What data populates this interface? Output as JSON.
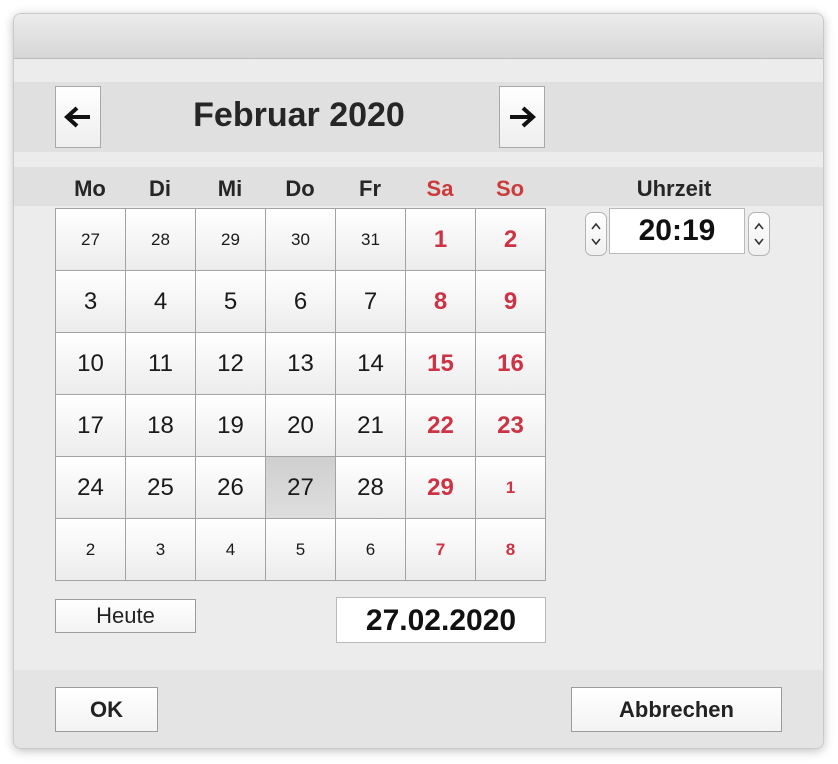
{
  "calendar": {
    "month_label": "Februar 2020",
    "prev_icon": "arrow-left-icon",
    "next_icon": "arrow-right-icon",
    "weekdays": [
      {
        "label": "Mo",
        "weekend": false
      },
      {
        "label": "Di",
        "weekend": false
      },
      {
        "label": "Mi",
        "weekend": false
      },
      {
        "label": "Do",
        "weekend": false
      },
      {
        "label": "Fr",
        "weekend": false
      },
      {
        "label": "Sa",
        "weekend": true
      },
      {
        "label": "So",
        "weekend": true
      }
    ],
    "weeks": [
      [
        {
          "d": "27",
          "other": true
        },
        {
          "d": "28",
          "other": true
        },
        {
          "d": "29",
          "other": true
        },
        {
          "d": "30",
          "other": true
        },
        {
          "d": "31",
          "other": true
        },
        {
          "d": "1"
        },
        {
          "d": "2"
        }
      ],
      [
        {
          "d": "3"
        },
        {
          "d": "4"
        },
        {
          "d": "5"
        },
        {
          "d": "6"
        },
        {
          "d": "7"
        },
        {
          "d": "8"
        },
        {
          "d": "9"
        }
      ],
      [
        {
          "d": "10"
        },
        {
          "d": "11"
        },
        {
          "d": "12"
        },
        {
          "d": "13"
        },
        {
          "d": "14"
        },
        {
          "d": "15"
        },
        {
          "d": "16"
        }
      ],
      [
        {
          "d": "17"
        },
        {
          "d": "18"
        },
        {
          "d": "19"
        },
        {
          "d": "20"
        },
        {
          "d": "21"
        },
        {
          "d": "22"
        },
        {
          "d": "23"
        }
      ],
      [
        {
          "d": "24"
        },
        {
          "d": "25"
        },
        {
          "d": "26"
        },
        {
          "d": "27",
          "selected": true
        },
        {
          "d": "28"
        },
        {
          "d": "29"
        },
        {
          "d": "1",
          "other": true
        }
      ],
      [
        {
          "d": "2",
          "other": true
        },
        {
          "d": "3",
          "other": true
        },
        {
          "d": "4",
          "other": true
        },
        {
          "d": "5",
          "other": true
        },
        {
          "d": "6",
          "other": true
        },
        {
          "d": "7",
          "other": true
        },
        {
          "d": "8",
          "other": true
        }
      ]
    ],
    "today_button": "Heute",
    "date_value": "27.02.2020"
  },
  "time": {
    "label": "Uhrzeit",
    "value": "20:19"
  },
  "footer": {
    "ok_label": "OK",
    "cancel_label": "Abbrechen"
  },
  "colors": {
    "weekend": "#cc3344",
    "background": "#ececec"
  }
}
